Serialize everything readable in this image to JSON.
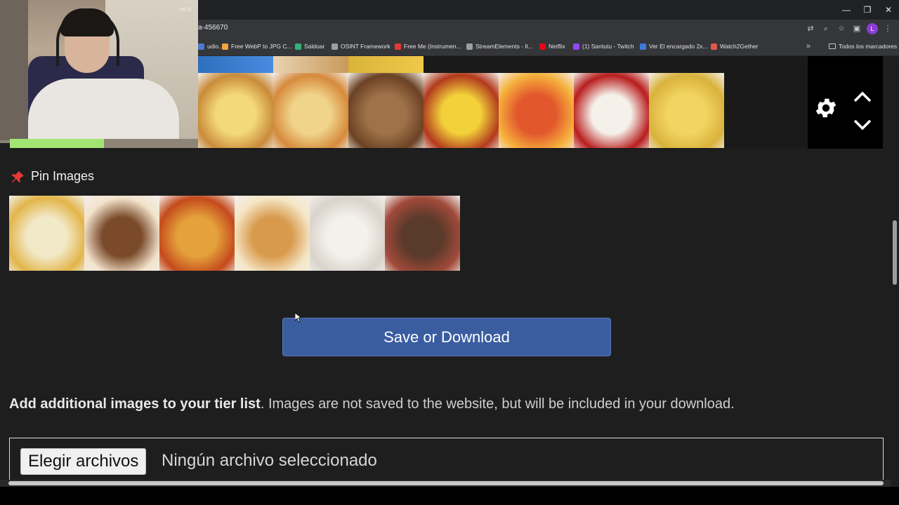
{
  "browser": {
    "url_fragment": "a-456670",
    "window_controls": [
      "—",
      "❐",
      "✕"
    ],
    "profile_initial": "L",
    "bookmarks": [
      {
        "label": "udio...",
        "color": "#4a7bd0"
      },
      {
        "label": "Free WebP to JPG C...",
        "color": "#f2a33a"
      },
      {
        "label": "Saldoar",
        "color": "#2fb37a"
      },
      {
        "label": "OSINT Framework",
        "color": "#9aa0a6"
      },
      {
        "label": "Free Me (Instrumen...",
        "color": "#e53935"
      },
      {
        "label": "StreamElements - Il...",
        "color": "#9aa0a6"
      },
      {
        "label": "Netflix",
        "color": "#e50914"
      },
      {
        "label": "(1) Santutu - Twitch",
        "color": "#9146ff"
      },
      {
        "label": "Ver El encargado 2x...",
        "color": "#3d7bd9"
      },
      {
        "label": "Watch2Gether",
        "color": "#e0584d"
      }
    ],
    "bookmarks_more": "»",
    "all_bookmarks": "Todos los marcadores"
  },
  "webcam": {
    "label": "m b"
  },
  "tier_controls": {
    "settings_icon": "gear-icon",
    "up_icon": "chevron-up-icon",
    "down_icon": "chevron-down-icon"
  },
  "tier_images": [
    {
      "name": "sponge-cake",
      "colors": [
        "#f4d97a",
        "#c98b3a"
      ]
    },
    {
      "name": "cannelloni",
      "colors": [
        "#f0d48a",
        "#d68a3c"
      ]
    },
    {
      "name": "croquettes",
      "colors": [
        "#a0724a",
        "#6b4224"
      ]
    },
    {
      "name": "polenta-with-sauce",
      "colors": [
        "#f2d13a",
        "#b23a1e"
      ]
    },
    {
      "name": "stew",
      "colors": [
        "#e2572c",
        "#f6b13c"
      ]
    },
    {
      "name": "strawberries-cream",
      "colors": [
        "#f5f1ea",
        "#b81d1d"
      ]
    },
    {
      "name": "omelette",
      "colors": [
        "#f2d462",
        "#d9b33c"
      ]
    }
  ],
  "pin": {
    "title": "Pin Images",
    "icon": "pushpin-icon",
    "images": [
      {
        "name": "chicken-soup",
        "colors": [
          "#f2e9c8",
          "#e2b54a"
        ]
      },
      {
        "name": "layer-cake",
        "colors": [
          "#7a4a2a",
          "#f3e3cc"
        ]
      },
      {
        "name": "spaghetti",
        "colors": [
          "#e5a23c",
          "#c44a1c"
        ]
      },
      {
        "name": "waffle",
        "colors": [
          "#d89a4c",
          "#f5e6c6"
        ]
      },
      {
        "name": "white-cake",
        "colors": [
          "#f4f1ec",
          "#d9d3cb"
        ]
      },
      {
        "name": "grilled-meat",
        "colors": [
          "#5a3a2a",
          "#a14a3a"
        ]
      }
    ]
  },
  "save_button": "Save or Download",
  "info": {
    "bold": "Add additional images to your tier list",
    "rest": ". Images are not saved to the website, but will be included in your download."
  },
  "file_input": {
    "button": "Elegir archivos",
    "status": "Ningún archivo seleccionado"
  }
}
